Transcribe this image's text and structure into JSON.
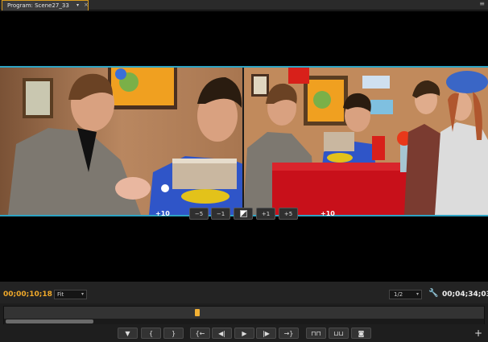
{
  "tab": {
    "label": "Program: Scene27_33",
    "menu_icon": "dropdown-arrow",
    "close_icon": "close"
  },
  "panel_menu_icon": "panel-menu",
  "trim": {
    "left_offset": "+10",
    "right_offset": "+10",
    "buttons": [
      "−5",
      "−1",
      "",
      "+1",
      "+5"
    ]
  },
  "status": {
    "timecode_current": "00;00;10;18",
    "zoom": "Fit",
    "resolution": "1/2",
    "timecode_duration": "00;04;34;03"
  },
  "colors": {
    "accent_tab": "#d79b1c",
    "trim_border": "#2ea3c3",
    "timecode": "#f0a92a",
    "playhead": "#f2b134"
  },
  "transport": {
    "buttons": [
      {
        "name": "add-marker-button",
        "icon": "marker"
      },
      {
        "name": "mark-in-button",
        "icon": "{"
      },
      {
        "name": "mark-out-button",
        "icon": "}"
      },
      {
        "name": "go-to-in-button",
        "icon": "{←"
      },
      {
        "name": "step-back-button",
        "icon": "◀|"
      },
      {
        "name": "play-button",
        "icon": "▶"
      },
      {
        "name": "step-forward-button",
        "icon": "|▶"
      },
      {
        "name": "go-to-out-button",
        "icon": "→}"
      },
      {
        "name": "lift-button",
        "icon": "lift"
      },
      {
        "name": "extract-button",
        "icon": "extract"
      },
      {
        "name": "export-frame-button",
        "icon": "camera"
      }
    ],
    "add_button": "+"
  }
}
